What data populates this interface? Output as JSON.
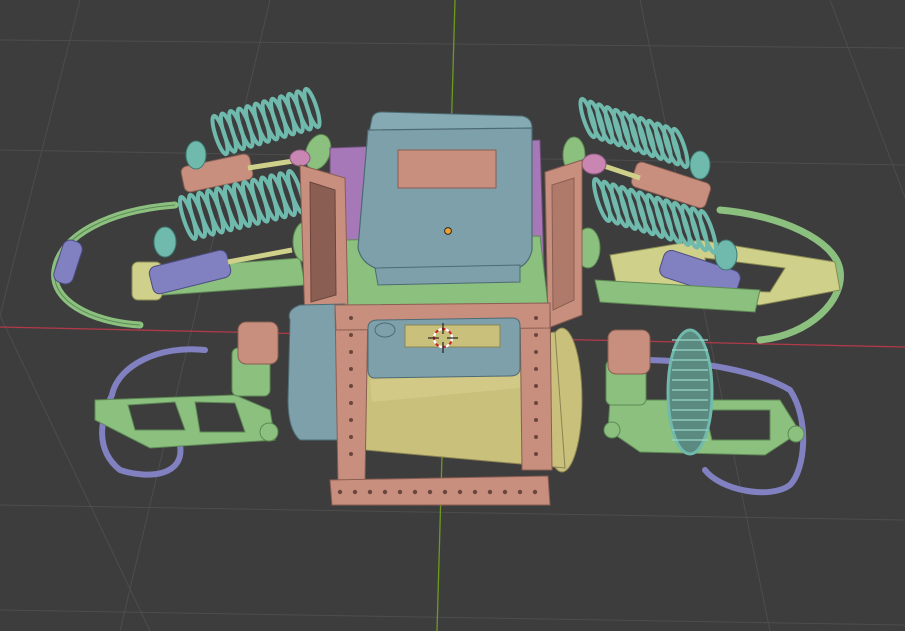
{
  "viewport": {
    "background": "#3d3d3d",
    "grid_color": "#4d4d4d",
    "x_axis_color": "#b0394a",
    "y_axis_color": "#6c9a1e"
  },
  "model": {
    "part_colors": {
      "frame": "#c88f7e",
      "tank": "#7ea0ab",
      "drum": "#c9c07c",
      "arm": "#8cc07f",
      "coil": "#6fb9ad",
      "rod": "#8180c0",
      "pink": "#c986b3",
      "purple": "#a778b7",
      "yellow_arm": "#cfd089"
    }
  },
  "overlays": {
    "origin_dot_color": "#f3a12a",
    "cursor_colors": [
      "#cc2a2a",
      "#ffffff"
    ]
  }
}
